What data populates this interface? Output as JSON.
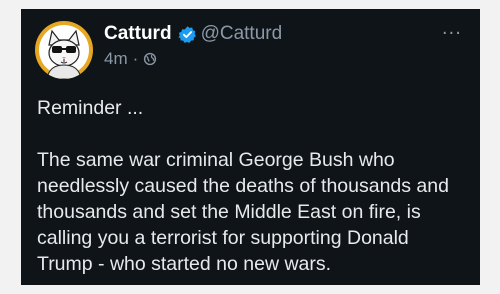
{
  "tweet": {
    "author": {
      "display_name": "Catturd",
      "handle": "@Catturd",
      "verified": true,
      "avatar_icon": "cat-with-glasses-avatar"
    },
    "timestamp": "4m",
    "separator": "·",
    "visibility_icon": "globe-icon",
    "more_label": "···",
    "paragraphs": [
      "Reminder ...",
      "The same war criminal George Bush who needlessly caused the deaths of thousands and thousands and set the Middle East on fire, is calling you a terrorist for supporting Donald Trump - who started no new wars."
    ]
  },
  "colors": {
    "background": "#0f1419",
    "text": "#e7e9ea",
    "secondary": "#8b98a5",
    "verified_blue": "#1d9bf0",
    "avatar_ring": "#e6a722"
  }
}
